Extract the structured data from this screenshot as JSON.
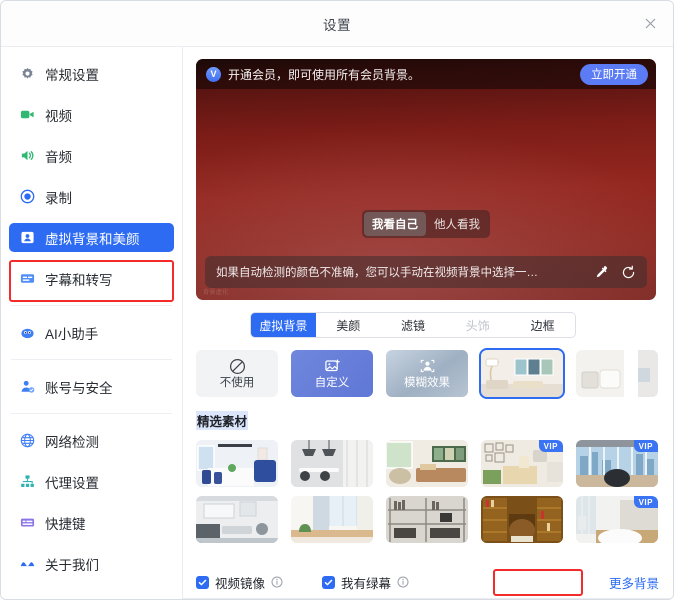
{
  "window": {
    "title": "设置",
    "close_icon": "close-icon"
  },
  "sidebar": {
    "items": [
      {
        "label": "常规设置",
        "icon": "gear-icon",
        "active": false
      },
      {
        "label": "视频",
        "icon": "video-camera-icon",
        "active": false
      },
      {
        "label": "音频",
        "icon": "speaker-icon",
        "active": false
      },
      {
        "label": "录制",
        "icon": "record-circle-icon",
        "active": false
      },
      {
        "label": "虚拟背景和美颜",
        "icon": "person-card-icon",
        "active": true
      },
      {
        "label": "字幕和转写",
        "icon": "caption-icon",
        "active": false
      },
      {
        "label": "AI小助手",
        "icon": "ai-assistant-icon",
        "active": false
      },
      {
        "label": "账号与安全",
        "icon": "account-security-icon",
        "active": false
      },
      {
        "label": "网络检测",
        "icon": "globe-icon",
        "active": false
      },
      {
        "label": "代理设置",
        "icon": "proxy-icon",
        "active": false
      },
      {
        "label": "快捷键",
        "icon": "keyboard-icon",
        "active": false
      },
      {
        "label": "关于我们",
        "icon": "about-icon",
        "active": false
      }
    ]
  },
  "preview": {
    "vip_banner": {
      "icon": "vip-badge-icon",
      "badge_letter": "V",
      "text": "开通会员，即可使用所有会员背景。",
      "button_label": "立即开通"
    },
    "view_toggle": {
      "options": [
        "我看自己",
        "他人看我"
      ],
      "selected": "我看自己"
    },
    "hint": {
      "text": "如果自动检测的颜色不准确，您可以手动在视频背景中选择一…",
      "eyedropper_icon": "eyedropper-icon",
      "reset_icon": "refresh-icon"
    },
    "watermark": "背景虚化"
  },
  "tabs": {
    "items": [
      {
        "label": "虚拟背景",
        "state": "selected"
      },
      {
        "label": "美颜",
        "state": "normal"
      },
      {
        "label": "滤镜",
        "state": "normal"
      },
      {
        "label": "头饰",
        "state": "disabled"
      },
      {
        "label": "边框",
        "state": "normal"
      }
    ]
  },
  "options_row": [
    {
      "label": "不使用",
      "kind": "none",
      "icon": "no-entry-icon",
      "selected": false
    },
    {
      "label": "自定义",
      "kind": "custom",
      "icon": "image-plus-icon",
      "selected": false
    },
    {
      "label": "模糊效果",
      "kind": "blur",
      "icon": "blur-person-icon",
      "selected": false
    },
    {
      "label": "",
      "kind": "thumb",
      "icon": "living-room-art-thumb",
      "selected": true
    },
    {
      "label": "",
      "kind": "thumb",
      "icon": "bedroom-white-thumb",
      "selected": false
    }
  ],
  "featured": {
    "title": "精选素材",
    "rows": [
      [
        {
          "name": "meeting-room-blue-sofa",
          "vip": false
        },
        {
          "name": "grey-dining-lamps",
          "vip": false
        },
        {
          "name": "living-room-window-plants",
          "vip": false
        },
        {
          "name": "green-armchair-gallery-wall",
          "vip": true
        },
        {
          "name": "city-view-office-chair",
          "vip": true
        }
      ],
      [
        {
          "name": "loft-living-grey",
          "vip": false
        },
        {
          "name": "bright-curtain-window",
          "vip": false
        },
        {
          "name": "industrial-bookshelf-desk",
          "vip": false
        },
        {
          "name": "wood-library-leather-chair",
          "vip": false
        },
        {
          "name": "white-meeting-table",
          "vip": true
        }
      ]
    ]
  },
  "footer": {
    "mirror": {
      "label": "视频镜像",
      "checked": true,
      "info_icon": "info-icon"
    },
    "greenscreen": {
      "label": "我有绿幕",
      "checked": true,
      "info_icon": "info-icon"
    },
    "more_link": "更多背景"
  },
  "highlights": {
    "accent": "#2c6bf2",
    "annotation_color": "#f32b2b",
    "targets": [
      "sidebar-item-虚拟背景和美颜",
      "greenscreen-checkbox"
    ]
  }
}
